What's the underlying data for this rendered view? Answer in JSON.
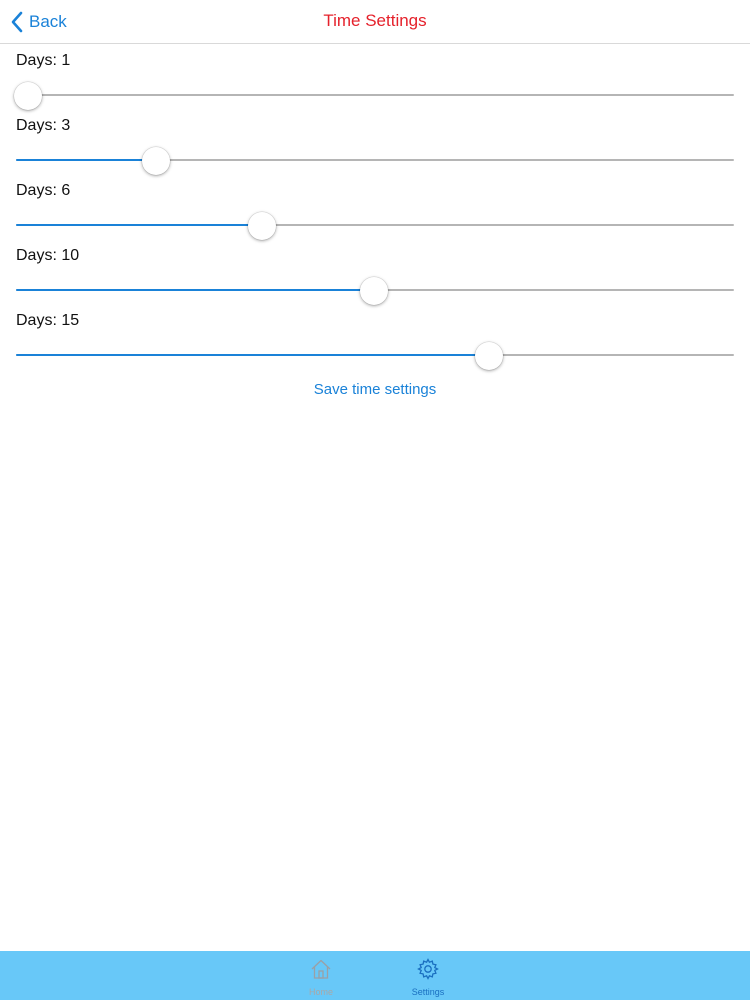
{
  "nav": {
    "back_label": "Back",
    "title": "Time Settings",
    "title_color": "#e5212b"
  },
  "sliders": [
    {
      "label": "Days: 1",
      "value_fraction": 0.017
    },
    {
      "label": "Days: 3",
      "value_fraction": 0.195
    },
    {
      "label": "Days: 6",
      "value_fraction": 0.343
    },
    {
      "label": "Days: 10",
      "value_fraction": 0.499
    },
    {
      "label": "Days: 15",
      "value_fraction": 0.659
    }
  ],
  "save_button_label": "Save time settings",
  "tabbar": {
    "background": "#68c8f8",
    "tabs": [
      {
        "label": "Home",
        "icon": "home-icon",
        "selected": false
      },
      {
        "label": "Settings",
        "icon": "gear-icon",
        "selected": true
      }
    ]
  },
  "colors": {
    "accent": "#1a82d8",
    "track": "#b5b5b5"
  }
}
